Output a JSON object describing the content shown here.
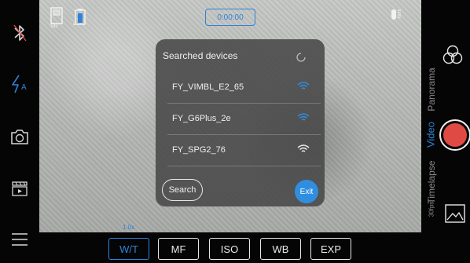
{
  "left_bar": {
    "icons": [
      "bluetooth-off-icon",
      "flash-auto-icon",
      "camera-switch-icon",
      "gallery-playback-icon",
      "menu-icon"
    ],
    "flash_label": "A"
  },
  "top_bar": {
    "storage_label": "SD",
    "recording_time": "0:00:00"
  },
  "dialog": {
    "title": "Searched devices",
    "devices": [
      {
        "name": "FY_VIMBL_E2_65",
        "signal_color": "#2f8ee0"
      },
      {
        "name": "FY_G6Plus_2e",
        "signal_color": "#2f8ee0"
      },
      {
        "name": "FY_SPG2_76",
        "signal_color": "#e8e8e8"
      }
    ],
    "search_label": "Search",
    "exit_label": "Exit"
  },
  "bottom_bar": {
    "zoom_label": "1.0x",
    "buttons": [
      "W/T",
      "MF",
      "ISO",
      "WB",
      "EXP"
    ],
    "active_button": "W/T"
  },
  "right_bar": {
    "modes": [
      "Panorama",
      "Video",
      "Timelapse"
    ],
    "active_mode": "Video",
    "small_label": "30fps"
  },
  "colors": {
    "accent": "#2f83d8",
    "record": "#e04a45"
  }
}
